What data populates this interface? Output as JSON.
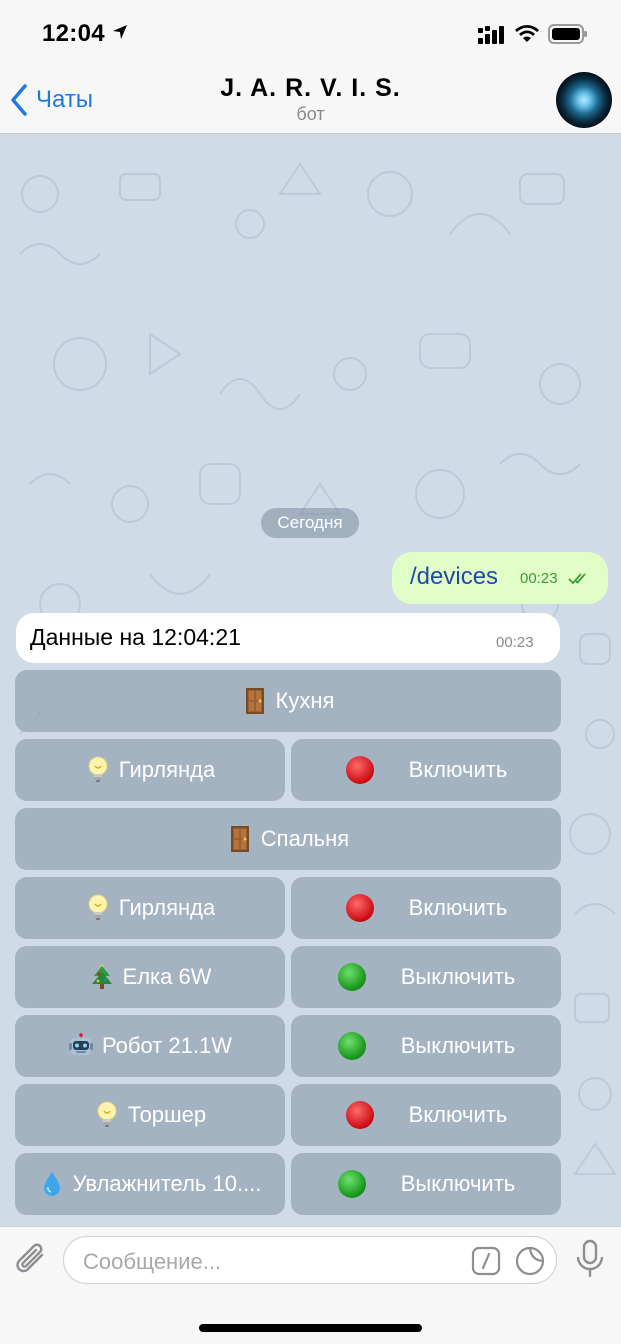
{
  "status_bar": {
    "time": "12:04"
  },
  "nav": {
    "back_label": "Чаты",
    "title": "J. A. R. V. I. S.",
    "subtitle": "бот"
  },
  "chat": {
    "date_chip": "Сегодня",
    "outgoing": {
      "text": "/devices",
      "time": "00:23",
      "status": "read"
    },
    "incoming": {
      "text": "Данные на 12:04:21",
      "time": "00:23"
    }
  },
  "keyboard": {
    "rows": [
      [
        {
          "icon": "door",
          "label": "Кухня"
        }
      ],
      [
        {
          "icon": "bulb",
          "label": "Гирлянда"
        },
        {
          "icon": "red-dot",
          "label": "Включить"
        }
      ],
      [
        {
          "icon": "door",
          "label": "Спальня"
        }
      ],
      [
        {
          "icon": "bulb",
          "label": "Гирлянда"
        },
        {
          "icon": "red-dot",
          "label": "Включить"
        }
      ],
      [
        {
          "icon": "christmas-tree",
          "label": "Елка 6W"
        },
        {
          "icon": "green-dot",
          "label": "Выключить"
        }
      ],
      [
        {
          "icon": "robot",
          "label": "Робот 21.1W"
        },
        {
          "icon": "green-dot",
          "label": "Выключить"
        }
      ],
      [
        {
          "icon": "bulb",
          "label": "Торшер"
        },
        {
          "icon": "red-dot",
          "label": "Включить"
        }
      ],
      [
        {
          "icon": "droplet",
          "label": "Увлажнитель 10...."
        },
        {
          "icon": "green-dot",
          "label": "Выключить"
        }
      ]
    ]
  },
  "input": {
    "placeholder": "Сообщение..."
  },
  "colors": {
    "accent": "#1f7ae0",
    "chat_bg": "#cfdbe7",
    "outgoing_bubble": "#e1fec6",
    "keyboard_button": "#96a5b6",
    "on_dot": "#1aa51a",
    "off_dot": "#e0141b"
  }
}
